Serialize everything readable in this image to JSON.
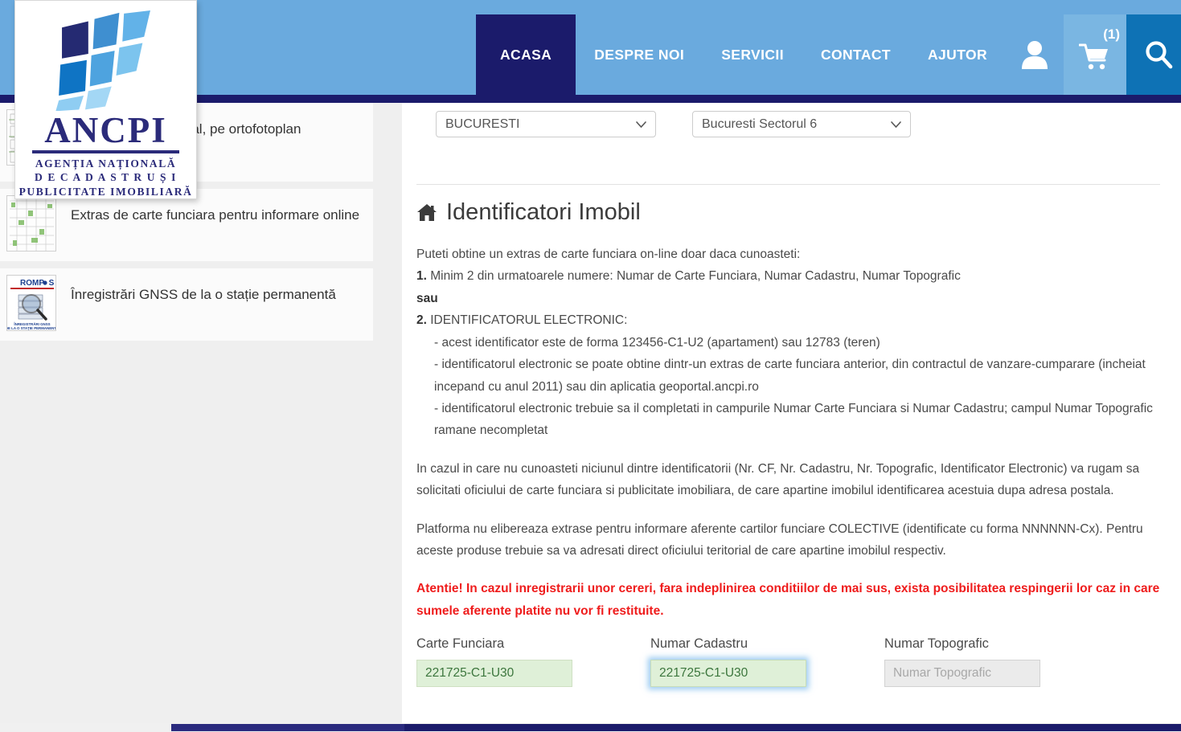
{
  "header": {
    "logo": {
      "word": "ANCPI",
      "sub_line1": "AGENȚIA NAȚIONALĂ",
      "sub_line2": "D E   C A D A S T R U   Ș I",
      "sub_line3": "PUBLICITATE IMOBILIARĂ"
    },
    "nav": [
      {
        "label": "ACASA",
        "active": true
      },
      {
        "label": "DESPRE NOI",
        "active": false
      },
      {
        "label": "SERVICII",
        "active": false
      },
      {
        "label": "CONTACT",
        "active": false
      },
      {
        "label": "AJUTOR",
        "active": false
      }
    ],
    "user_icon": "user-icon",
    "cart_icon": "cart-icon",
    "cart_badge": "(1)",
    "search_icon": "search-icon",
    "colors": {
      "header_blue": "#6aaade",
      "navy": "#1b1b6b",
      "cart_blue": "#7ab6e2",
      "search_blue": "#0e72b5"
    }
  },
  "sidebar": {
    "items": [
      {
        "label": "astral, pe ortofotoplan",
        "thumb": "cadastral-map-thumb"
      },
      {
        "label": "Extras de carte funciara pentru informare online",
        "thumb": "land-registry-map-thumb"
      },
      {
        "label": "Înregistrări GNSS de la o stație permanentă",
        "thumb": "rompos-logo-thumb"
      }
    ]
  },
  "main": {
    "selects": [
      {
        "name": "judet-select",
        "value": "BUCURESTI"
      },
      {
        "name": "localitate-select",
        "value": "Bucuresti Sectorul 6"
      }
    ],
    "section": {
      "icon": "home-icon",
      "title": "Identificatori Imobil"
    },
    "intro": "Puteti obtine un extras de carte funciara on-line doar daca cunoasteti:",
    "item1_num": "1.",
    "item1_text": " Minim 2 din urmatoarele numere: Numar de Carte Funciara, Numar Cadastru, Numar Topografic",
    "sau": "sau",
    "item2_num": "2.",
    "item2_text": " IDENTIFICATORUL ELECTRONIC:",
    "bullet1": "- acest identificator este de forma 123456-C1-U2 (apartament) sau 12783 (teren)",
    "bullet2": "- identificatorul electronic se poate obtine dintr-un extras de carte funciara anterior, din contractul de vanzare-cumparare (incheiat incepand cu anul 2011) sau din aplicatia geoportal.ancpi.ro",
    "bullet3": "- identificatorul electronic trebuie sa il completati in campurile Numar Carte Funciara si Numar Cadastru; campul Numar Topografic ramane necompletat",
    "para1": "In cazul in care nu cunoasteti niciunul dintre identificatorii (Nr. CF, Nr. Cadastru, Nr. Topografic, Identificator Electronic) va rugam sa solicitati oficiului de carte funciara si publicitate imobiliara, de care apartine imobilul identificarea acestuia dupa adresa postala.",
    "para2": "Platforma nu elibereaza extrase pentru informare aferente cartilor funciare COLECTIVE (identificate cu forma NNNNNN-Cx). Pentru aceste produse trebuie sa va adresati direct oficiului teritorial de care apartine imobilul respectiv.",
    "warning": "Atentie! In cazul inregistrarii unor cereri, fara indeplinirea conditiilor de mai sus, exista posibilitatea respingerii lor caz in care sumele aferente platite nu vor fi restituite.",
    "warning_color": "#ef1c1c",
    "fields": [
      {
        "name": "carte-funciara-field",
        "label": "Carte Funciara",
        "value": "221725-C1-U30",
        "placeholder": "Carte Funciara",
        "state": "filled"
      },
      {
        "name": "numar-cadastru-field",
        "label": "Numar Cadastru",
        "value": "221725-C1-U30",
        "placeholder": "Numar Cadastru",
        "state": "focused"
      },
      {
        "name": "numar-topografic-field",
        "label": "Numar Topografic",
        "value": "",
        "placeholder": "Numar Topografic",
        "state": "disabled"
      }
    ]
  }
}
